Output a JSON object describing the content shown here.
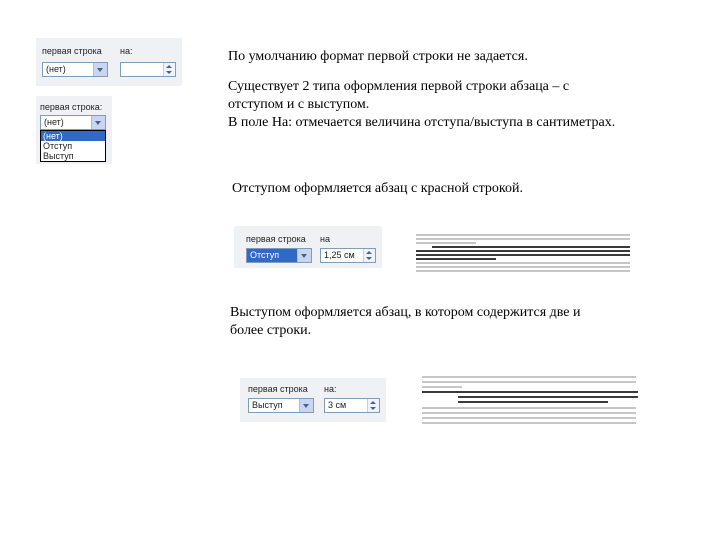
{
  "panel1": {
    "label_first_line": "первая строка",
    "label_on": "на:",
    "combo_value": "(нет)"
  },
  "panel2": {
    "label_first_line": "первая строка:",
    "combo_value": "(нет)",
    "options": [
      "(нет)",
      "Отступ",
      "Выступ"
    ]
  },
  "panel3": {
    "label_first_line": "первая строка",
    "label_on": "на",
    "combo_value": "Отступ",
    "spin_value": "1,25 см"
  },
  "panel4": {
    "label_first_line": "первая строка",
    "label_on": "на:",
    "combo_value": "Выступ",
    "spin_value": "3 см"
  },
  "text": {
    "line1": "По умолчанию формат первой строки не задается.",
    "line2a": "Существует 2 типа оформления первой строки абзаца – с",
    "line2b": "отступом и с выступом.",
    "line3": "В поле На: отмечается величина отступа/выступа в сантиметрах.",
    "line4": "Отступом оформляется абзац с красной строкой.",
    "line5a": "Выступом оформляется абзац, в котором содержится две и",
    "line5b": "более строки."
  },
  "colors": {
    "panel_bg": "#f0f1f4",
    "selection": "#316ac5",
    "field_border": "#7f9db9"
  }
}
